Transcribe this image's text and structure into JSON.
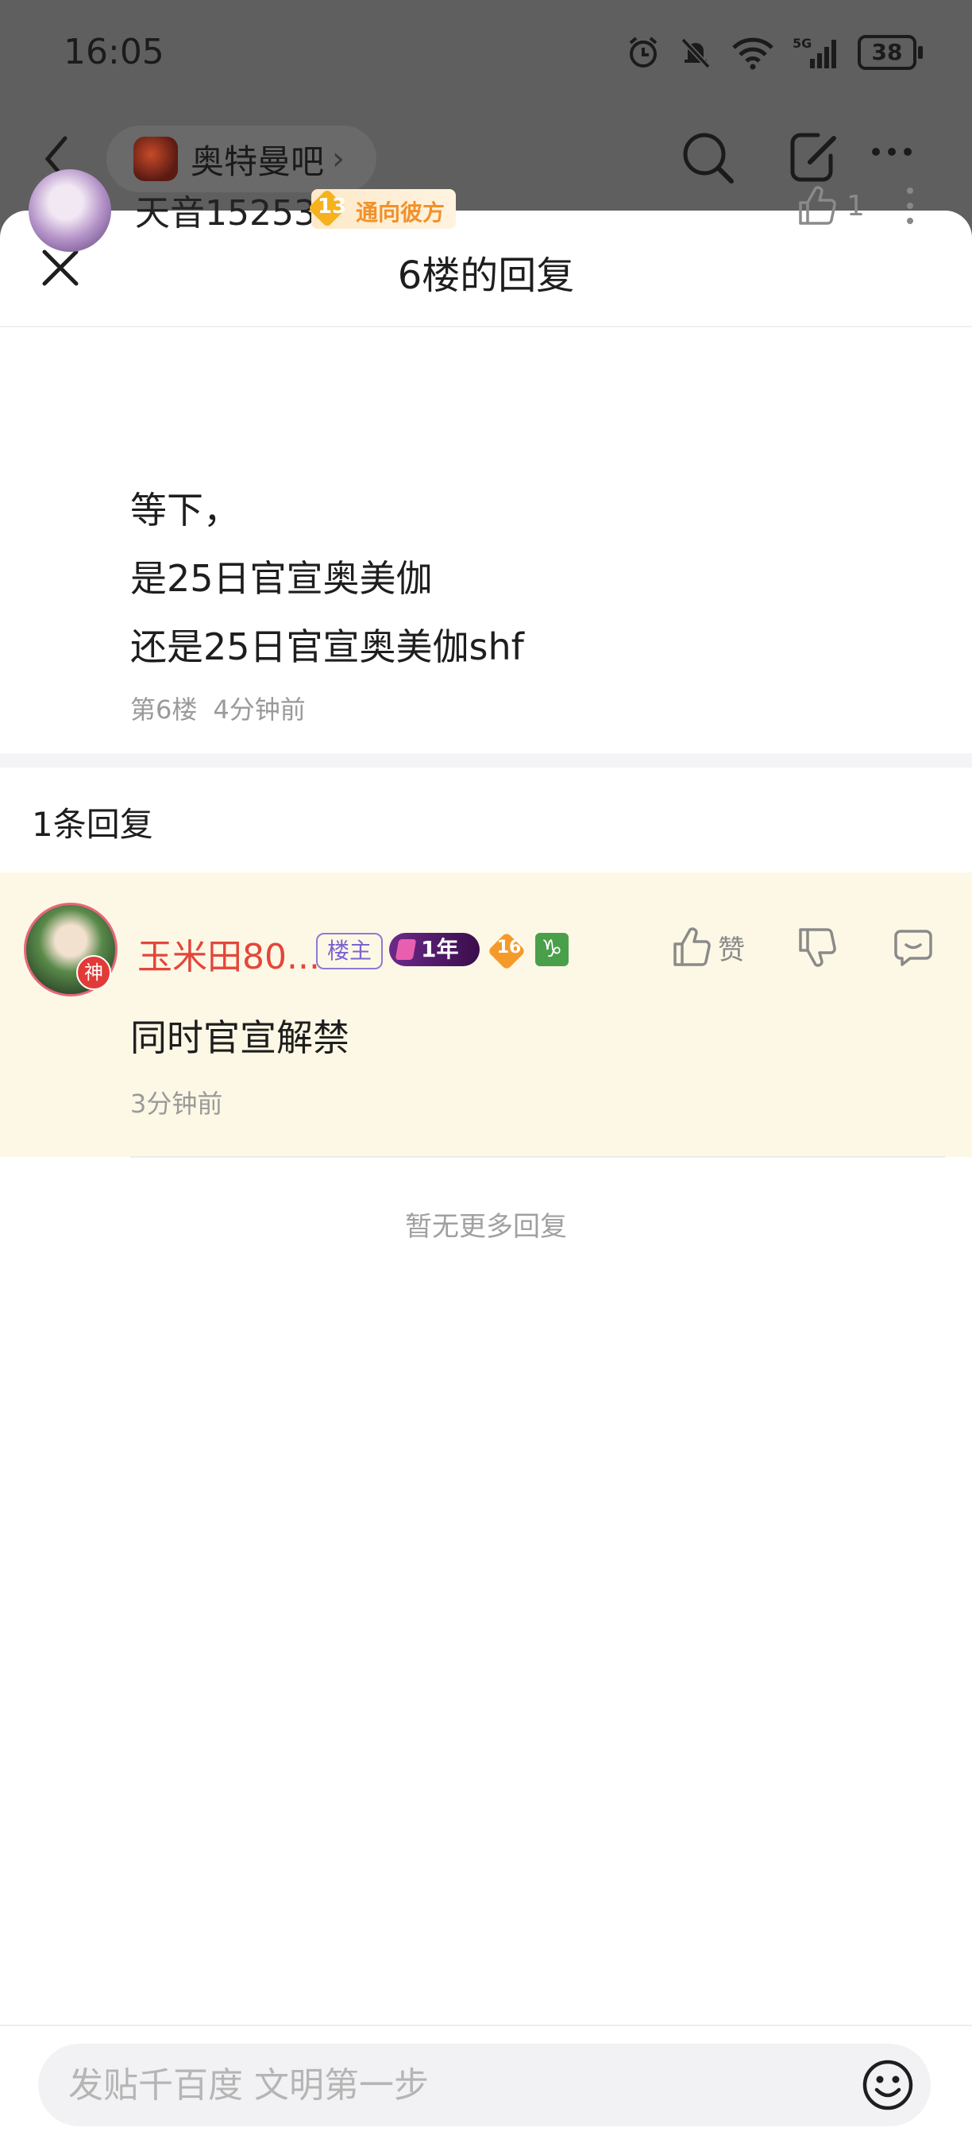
{
  "status_bar": {
    "time": "16:05",
    "battery": "38"
  },
  "background_nav": {
    "forum_name": "奥特曼吧"
  },
  "sheet": {
    "title": "6楼的回复"
  },
  "main_post": {
    "username": "天音15253",
    "level": "13",
    "level_title": "通向彼方",
    "like_count": "1",
    "content_lines": [
      "等下，",
      "是25日官宣奥美伽",
      "还是25日官宣奥美伽shf"
    ],
    "floor": "第6楼",
    "time": "4分钟前"
  },
  "reply_count_label": "1条回复",
  "replies": [
    {
      "username": "玉米田80...",
      "op_tag": "楼主",
      "year_badge": "1年",
      "level": "16",
      "zodiac": "♑",
      "avatar_badge": "神",
      "like_label": "赞",
      "content": "同时官宣解禁",
      "time": "3分钟前"
    }
  ],
  "no_more_label": "暂无更多回复",
  "input": {
    "placeholder": "发贴千百度 文明第一步"
  }
}
